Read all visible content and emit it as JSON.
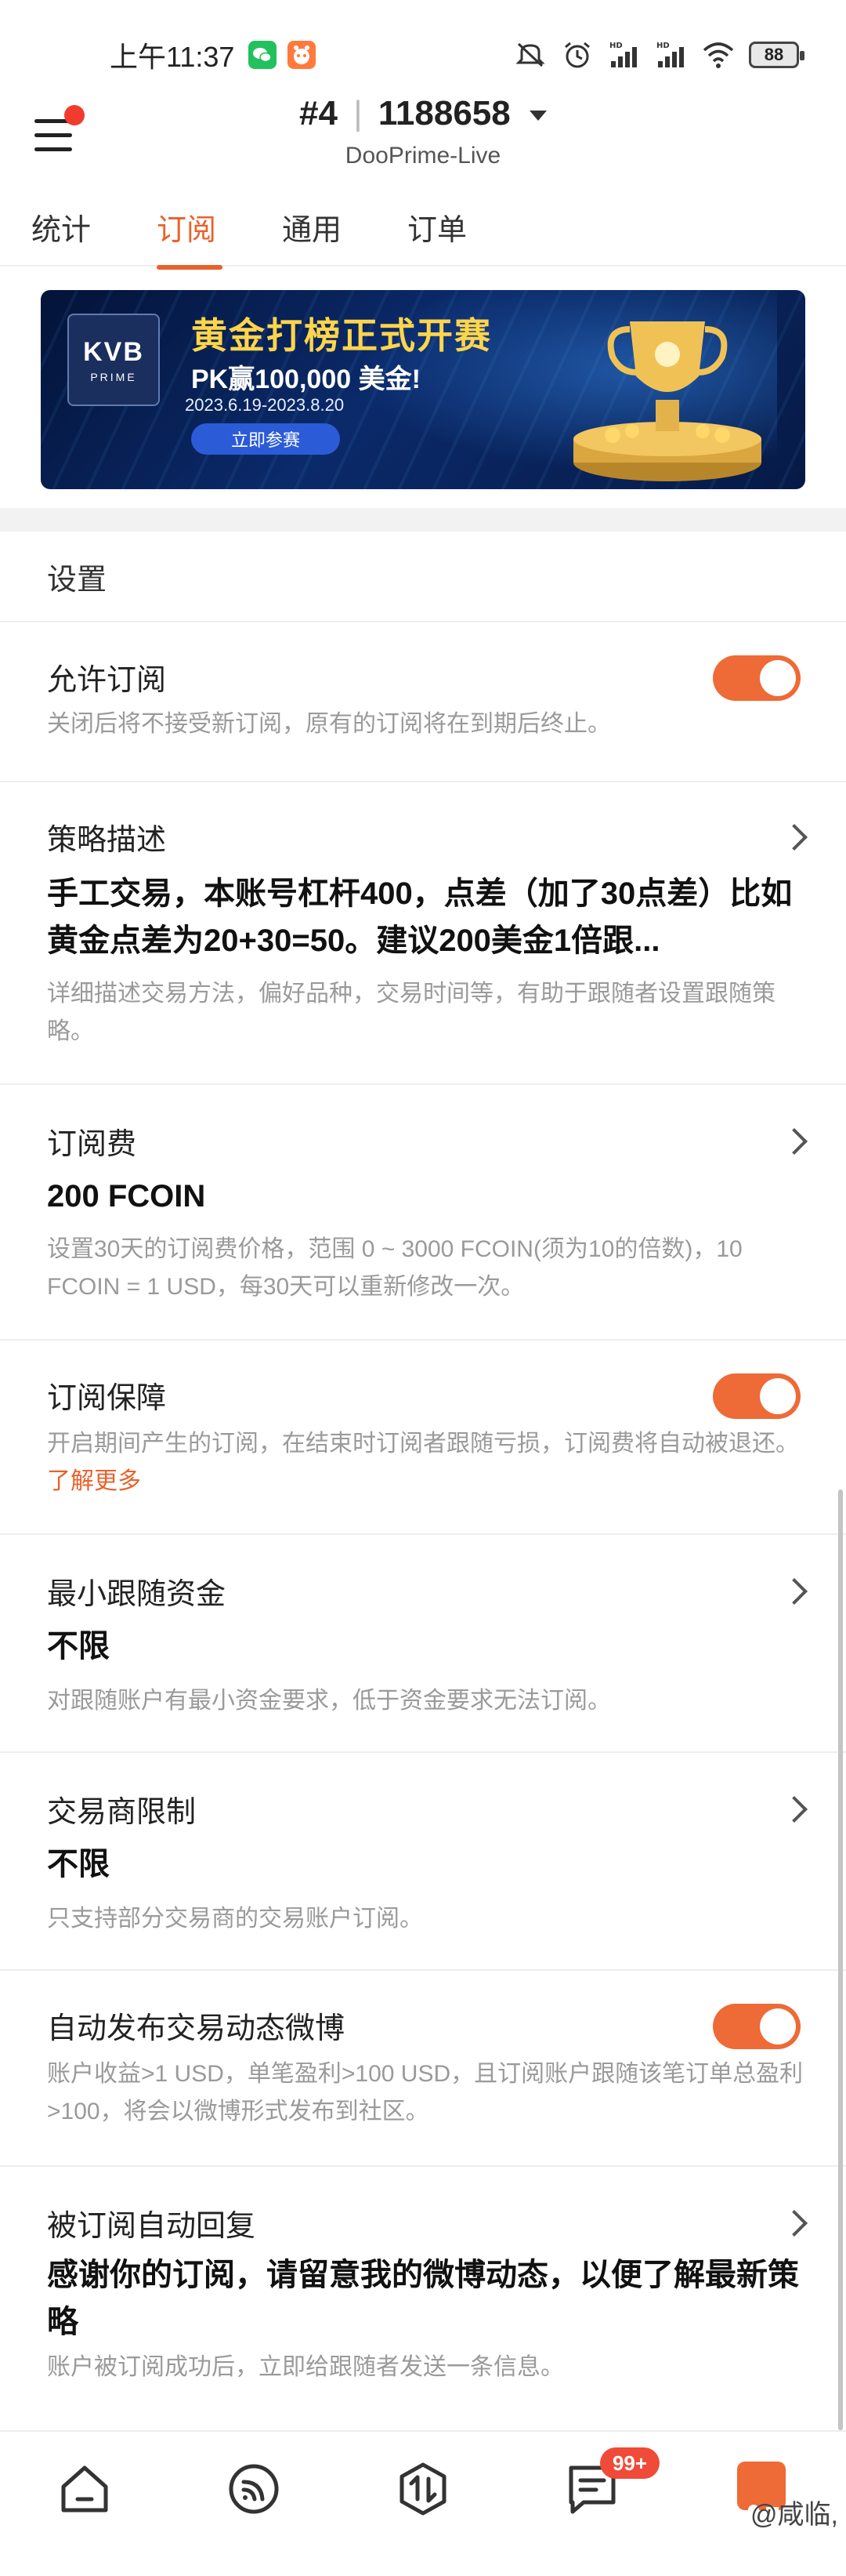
{
  "status_bar": {
    "time": "上午11:37",
    "battery": "88",
    "icons": [
      "wechat-icon",
      "app-icon",
      "mute-icon",
      "alarm-icon",
      "signal-hd-icon",
      "signal-hd-icon",
      "wifi-icon"
    ]
  },
  "header": {
    "account_prefix": "#4",
    "account_number": "1188658",
    "server": "DooPrime-Live"
  },
  "tabs": [
    {
      "label": "统计"
    },
    {
      "label": "订阅"
    },
    {
      "label": "通用"
    },
    {
      "label": "订单"
    }
  ],
  "banner": {
    "logo_text": "KVB",
    "logo_sub": "PRIME",
    "title": "黄金打榜正式开赛",
    "subtitle": "PK赢100,000 美金!",
    "dates": "2023.6.19-2023.8.20",
    "button": "立即参赛"
  },
  "settings": {
    "title": "设置",
    "allow_subscription": {
      "label": "允许订阅",
      "desc": "关闭后将不接受新订阅，原有的订阅将在到期后终止。",
      "enabled": true
    },
    "strategy": {
      "label": "策略描述",
      "value": "手工交易，本账号杠杆400，点差（加了30点差）比如黄金点差为20+30=50。建议200美金1倍跟...",
      "desc": "详细描述交易方法，偏好品种，交易时间等，有助于跟随者设置跟随策略。"
    },
    "fee": {
      "label": "订阅费",
      "value": "200 FCOIN",
      "desc": "设置30天的订阅费价格，范围 0 ~ 3000 FCOIN(须为10的倍数)，10 FCOIN = 1 USD，每30天可以重新修改一次。"
    },
    "guarantee": {
      "label": "订阅保障",
      "desc": "开启期间产生的订阅，在结束时订阅者跟随亏损，订阅费将自动被退还。",
      "link": "了解更多",
      "enabled": true
    },
    "min_funds": {
      "label": "最小跟随资金",
      "value": "不限",
      "desc": "对跟随账户有最小资金要求，低于资金要求无法订阅。"
    },
    "broker_limit": {
      "label": "交易商限制",
      "value": "不限",
      "desc": "只支持部分交易商的交易账户订阅。"
    },
    "auto_post": {
      "label": "自动发布交易动态微博",
      "desc": "账户收益>1 USD，单笔盈利>100 USD，且订阅账户跟随该笔订单总盈利>100，将会以微博形式发布到社区。",
      "enabled": true
    },
    "auto_reply": {
      "label": "被订阅自动回复",
      "value": "感谢你的订阅，请留意我的微博动态，以便了解最新策略",
      "desc": "账户被订阅成功后，立即给跟随者发送一条信息。"
    }
  },
  "bottom_nav": {
    "items": [
      "home-icon",
      "feed-icon",
      "trade-icon",
      "messages-icon",
      "profile-icon"
    ],
    "badge": "99+"
  },
  "watermark": "@咸临,",
  "colors": {
    "accent": "#e8622c",
    "toggle_on": "#ee6a36",
    "badge": "#f04a38",
    "desc_text": "#9a9a9a"
  }
}
